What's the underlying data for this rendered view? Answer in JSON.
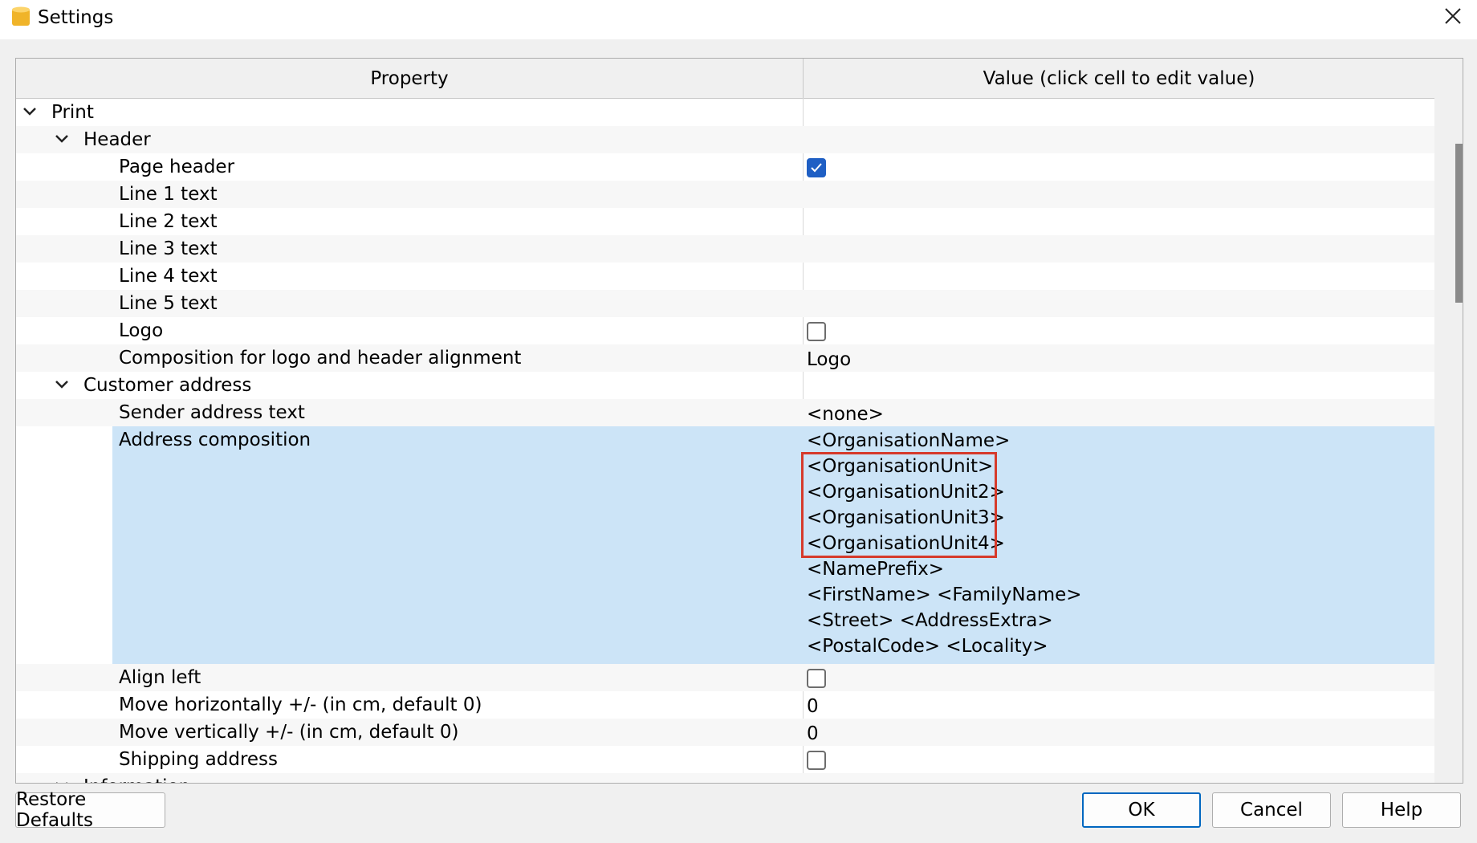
{
  "window": {
    "title": "Settings"
  },
  "grid": {
    "header": {
      "property": "Property",
      "value": "Value (click cell to edit value)"
    },
    "rows": [
      {
        "label": "Print",
        "indent": 0,
        "expander": true
      },
      {
        "label": "Header",
        "indent": 1,
        "expander": true
      },
      {
        "label": "Page header",
        "indent": 2,
        "checkbox": true,
        "checked": true
      },
      {
        "label": "Line 1 text",
        "indent": 2
      },
      {
        "label": "Line 2 text",
        "indent": 2
      },
      {
        "label": "Line 3 text",
        "indent": 2
      },
      {
        "label": "Line 4 text",
        "indent": 2
      },
      {
        "label": "Line 5 text",
        "indent": 2
      },
      {
        "label": "Logo",
        "indent": 2,
        "checkbox": true,
        "checked": false
      },
      {
        "label": "Composition for logo and header alignment",
        "indent": 2,
        "value": "Logo"
      },
      {
        "label": "Customer address",
        "indent": 1,
        "expander": true
      },
      {
        "label": "Sender address text",
        "indent": 2,
        "value": "<none>"
      },
      {
        "label": "Address composition",
        "indent": 2,
        "selected": true,
        "value_lines": [
          "<OrganisationName>",
          "<OrganisationUnit>",
          "<OrganisationUnit2>",
          "<OrganisationUnit3>",
          "<OrganisationUnit4>",
          "<NamePrefix>",
          "<FirstName>  <FamilyName>",
          "<Street>  <AddressExtra>",
          "<PostalCode>  <Locality>"
        ]
      },
      {
        "label": "Align left",
        "indent": 2,
        "checkbox": true,
        "checked": false
      },
      {
        "label": "Move horizontally +/- (in cm, default 0)",
        "indent": 2,
        "value": "0"
      },
      {
        "label": "Move vertically +/- (in cm, default 0)",
        "indent": 2,
        "value": "0"
      },
      {
        "label": "Shipping address",
        "indent": 2,
        "checkbox": true,
        "checked": false
      },
      {
        "label": "Information",
        "indent": 1,
        "expander": true
      }
    ]
  },
  "buttons": {
    "restore": "Restore Defaults",
    "ok": "OK",
    "cancel": "Cancel",
    "help": "Help"
  },
  "colors": {
    "selection": "#cce4f7",
    "highlight_box": "#d63a2b",
    "checkbox_checked": "#1f5fc4"
  }
}
